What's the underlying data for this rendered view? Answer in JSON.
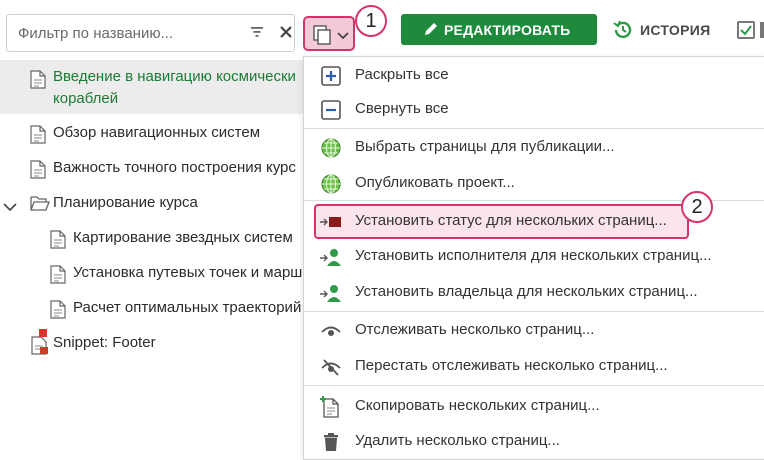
{
  "toolbar": {
    "filter_placeholder": "Фильтр по названию...",
    "edit_label": "РЕДАКТИРОВАТЬ",
    "history_label": "ИСТОРИЯ",
    "accent_green": "#1e8a3c",
    "highlight_pink": "#d6336c"
  },
  "callouts": [
    "1",
    "2"
  ],
  "tree": [
    {
      "label_line1": "Введение в навигацию космически",
      "label_line2": "кораблей",
      "icon": "page-icon",
      "selected": true
    },
    {
      "label": "Обзор навигационных систем",
      "icon": "page-icon"
    },
    {
      "label": "Важность точного построения курс",
      "icon": "page-icon"
    },
    {
      "label": "Планирование курса",
      "icon": "folder-open-icon",
      "expanded": true
    },
    {
      "label": "Картирование звездных систем",
      "icon": "page-icon",
      "child": true
    },
    {
      "label": "Установка путевых точек и марш",
      "icon": "page-icon",
      "child": true
    },
    {
      "label": "Расчет оптимальных траекторий",
      "icon": "page-icon",
      "child": true
    },
    {
      "label": "Snippet: Footer",
      "icon": "snippet-icon"
    }
  ],
  "menu": [
    {
      "label": "Раскрыть все",
      "icon": "expand-all-icon"
    },
    {
      "label": "Свернуть все",
      "icon": "collapse-all-icon"
    },
    {
      "label": "Выбрать страницы для публикации...",
      "icon": "globe-icon"
    },
    {
      "label": "Опубликовать проект...",
      "icon": "globe-icon"
    },
    {
      "label": "Установить статус для нескольких страниц...",
      "icon": "status-icon",
      "highlighted": true
    },
    {
      "label": "Установить исполнителя для нескольких страниц...",
      "icon": "assign-user-icon"
    },
    {
      "label": "Установить владельца для нескольких страниц...",
      "icon": "assign-user-icon"
    },
    {
      "label": "Отслеживать несколько страниц...",
      "icon": "eye-icon"
    },
    {
      "label": "Перестать отслеживать несколько страниц...",
      "icon": "eye-off-icon"
    },
    {
      "label": "Скопировать нескольких страниц...",
      "icon": "copy-page-icon"
    },
    {
      "label": "Удалить несколько страниц...",
      "icon": "trash-icon"
    }
  ]
}
